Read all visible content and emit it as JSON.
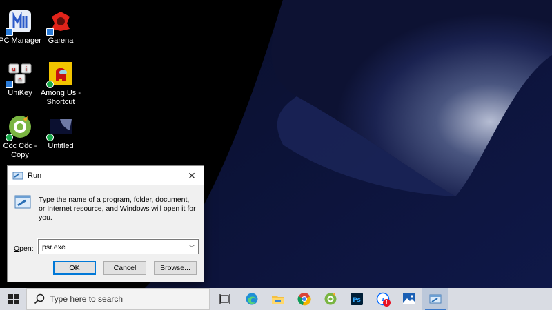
{
  "desktop": {
    "icons": [
      {
        "label": "PC Manager",
        "icon": "pc-manager-icon",
        "badge": "shortcut"
      },
      {
        "label": "Garena",
        "icon": "garena-icon",
        "badge": "shortcut"
      },
      {
        "label": "UniKey",
        "icon": "unikey-icon",
        "badge": "shortcut"
      },
      {
        "label": "Among Us - Shortcut",
        "icon": "among-us-icon",
        "badge": "sync"
      },
      {
        "label": "Cốc Cốc - Copy",
        "icon": "coccoc-icon",
        "badge": "sync"
      },
      {
        "label": "Untitled",
        "icon": "untitled-image-icon",
        "badge": "sync"
      }
    ]
  },
  "run_dialog": {
    "title": "Run",
    "description": "Type the name of a program, folder, document, or Internet resource, and Windows will open it for you.",
    "open_label_mnemonic": "O",
    "open_label_rest": "pen:",
    "input_value": "psr.exe",
    "buttons": {
      "ok": "OK",
      "cancel": "Cancel",
      "browse": "Browse..."
    }
  },
  "taskbar": {
    "search_placeholder": "Type here to search",
    "notification_count": "1",
    "apps": [
      "task-view-icon",
      "edge-icon",
      "file-explorer-icon",
      "chrome-icon",
      "coccoc-icon",
      "photoshop-icon",
      "zalo-icon",
      "photos-icon",
      "run-icon"
    ]
  },
  "colors": {
    "accent": "#0078d7",
    "taskbar": "#d9dce3",
    "dialog": "#f0f0f0"
  }
}
